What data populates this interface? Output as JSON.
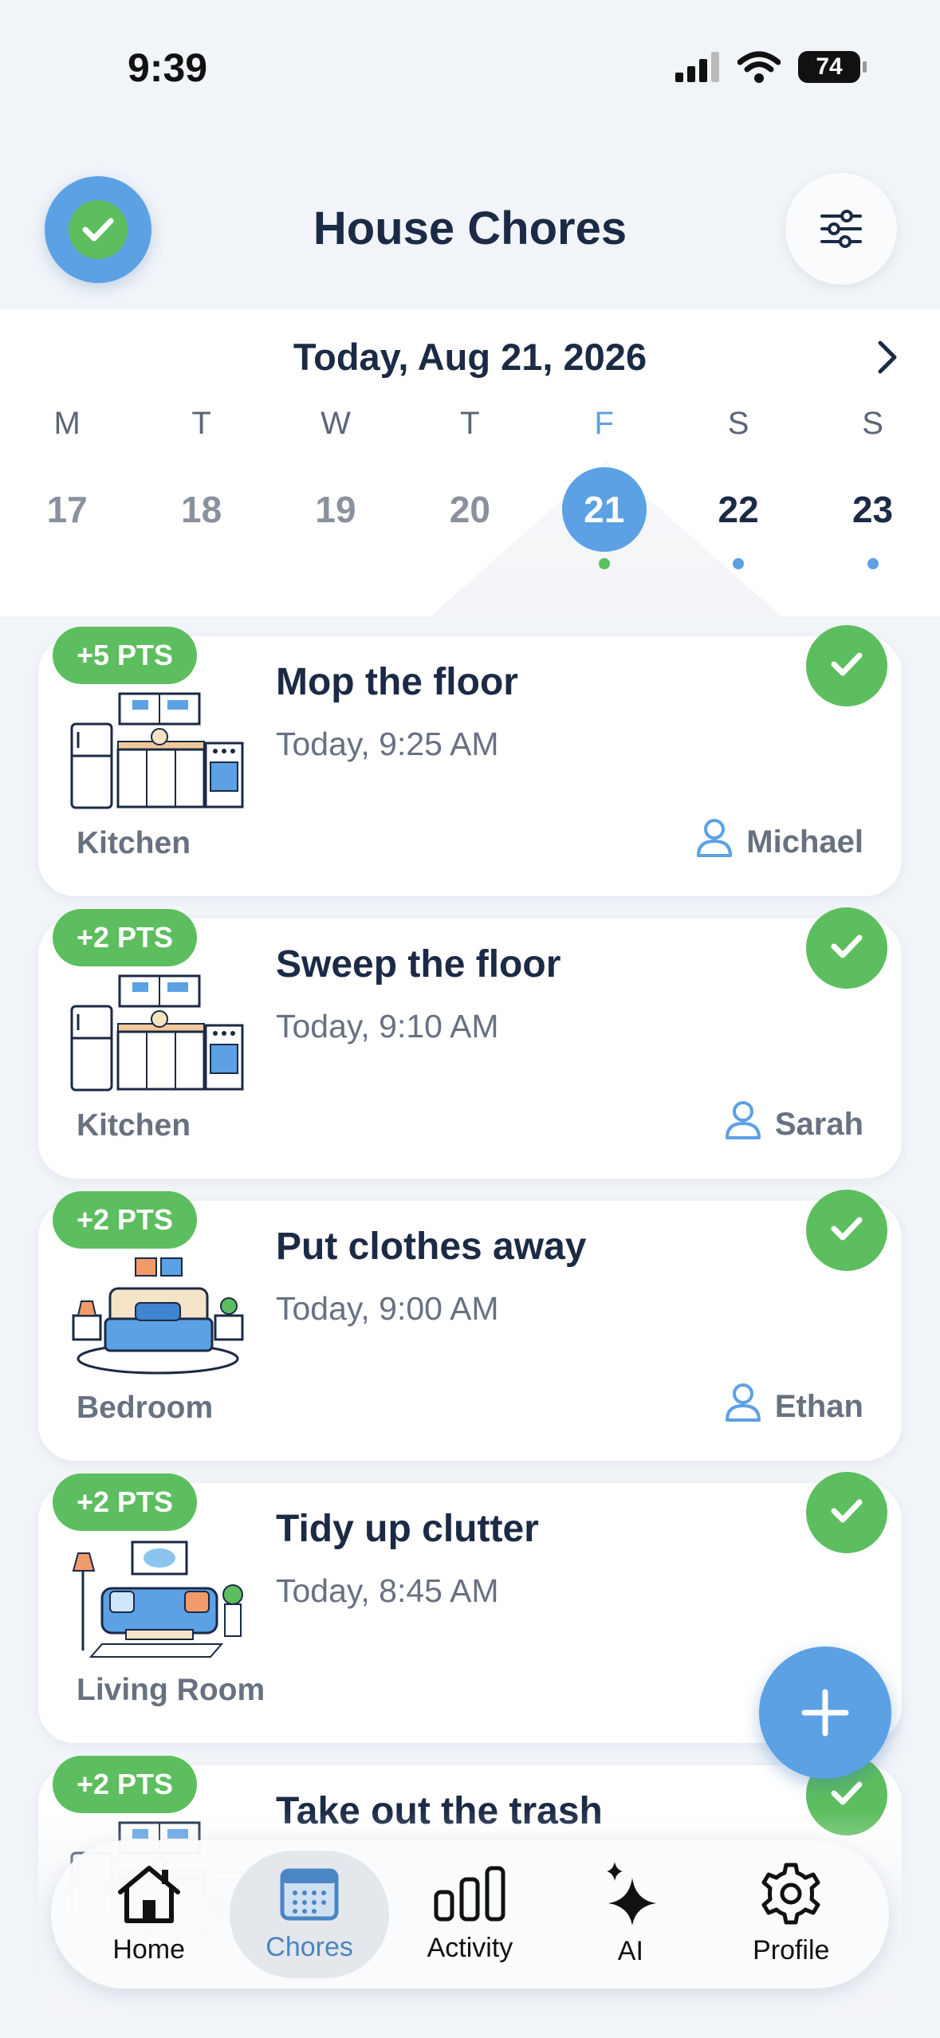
{
  "status": {
    "time": "9:39",
    "battery": "74"
  },
  "header": {
    "title": "House Chores"
  },
  "calendar": {
    "date_label": "Today, Aug 21, 2026",
    "days": [
      {
        "letter": "M",
        "num": "17",
        "state": "past"
      },
      {
        "letter": "T",
        "num": "18",
        "state": "past"
      },
      {
        "letter": "W",
        "num": "19",
        "state": "past"
      },
      {
        "letter": "T",
        "num": "20",
        "state": "past"
      },
      {
        "letter": "F",
        "num": "21",
        "state": "active",
        "dot": "#5dbe5f"
      },
      {
        "letter": "S",
        "num": "22",
        "state": "future",
        "dot": "#5ba1e4"
      },
      {
        "letter": "S",
        "num": "23",
        "state": "future",
        "dot": "#5ba1e4"
      }
    ]
  },
  "chores": [
    {
      "points": "+5 PTS",
      "title": "Mop the floor",
      "time": "Today, 9:25 AM",
      "room": "Kitchen",
      "person": "Michael",
      "image": "kitchen-illustration"
    },
    {
      "points": "+2 PTS",
      "title": "Sweep the floor",
      "time": "Today, 9:10 AM",
      "room": "Kitchen",
      "person": "Sarah",
      "image": "kitchen-illustration"
    },
    {
      "points": "+2 PTS",
      "title": "Put clothes away",
      "time": "Today, 9:00 AM",
      "room": "Bedroom",
      "person": "Ethan",
      "image": "bedroom-illustration"
    },
    {
      "points": "+2 PTS",
      "title": "Tidy up clutter",
      "time": "Today, 8:45 AM",
      "room": "Living Room",
      "person": "",
      "image": "living-room-illustration"
    },
    {
      "points": "+2 PTS",
      "title": "Take out the trash",
      "time": "",
      "room": "",
      "person": "",
      "image": "kitchen-illustration"
    }
  ],
  "tabs": [
    {
      "label": "Home",
      "icon": "home-icon"
    },
    {
      "label": "Chores",
      "icon": "calendar-icon",
      "active": true
    },
    {
      "label": "Activity",
      "icon": "bar-chart-icon"
    },
    {
      "label": "AI",
      "icon": "sparkle-icon"
    },
    {
      "label": "Profile",
      "icon": "gear-icon"
    }
  ],
  "colors": {
    "accent": "#5ba1e4",
    "success": "#5dbe5f",
    "text": "#1b2a45",
    "muted": "#687180"
  }
}
